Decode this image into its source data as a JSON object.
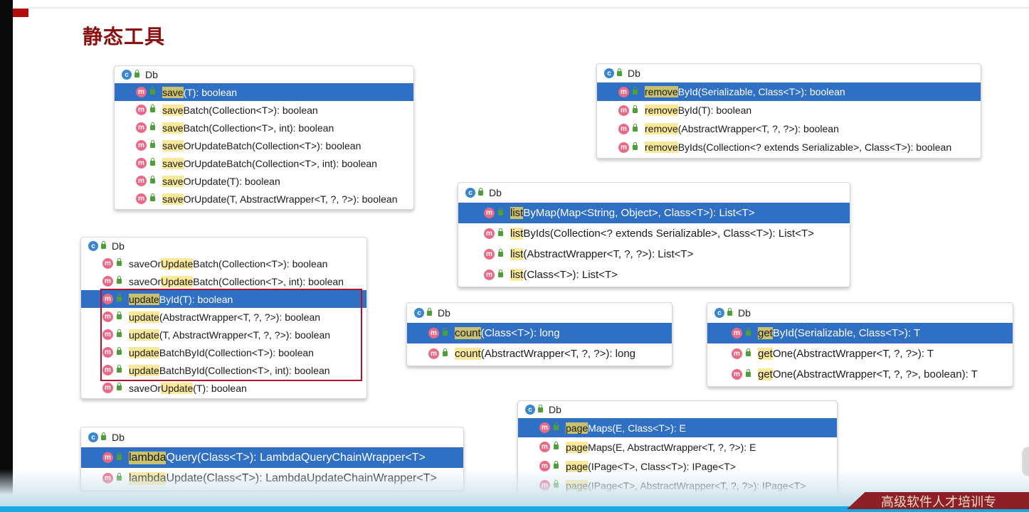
{
  "title": "静态工具",
  "brand_text": "高级软件人才培训专",
  "colors": {
    "accent": "#2f6fc4",
    "title": "#8b1111",
    "highlight": "#fbe99a",
    "box": "#b0142b"
  },
  "panels": [
    {
      "id": "save",
      "header": "Db",
      "sel": 0,
      "rows": [
        {
          "hl": "save",
          "rest": "(T): boolean"
        },
        {
          "hl": "save",
          "rest": "Batch(Collection<T>): boolean"
        },
        {
          "hl": "save",
          "rest": "Batch(Collection<T>, int): boolean"
        },
        {
          "hl": "save",
          "rest": "OrUpdateBatch(Collection<T>): boolean"
        },
        {
          "hl": "save",
          "rest": "OrUpdateBatch(Collection<T>, int): boolean"
        },
        {
          "hl": "save",
          "rest": "OrUpdate(T): boolean"
        },
        {
          "hl": "save",
          "rest": "OrUpdate(T, AbstractWrapper<T, ?, ?>): boolean"
        }
      ]
    },
    {
      "id": "remove",
      "header": "Db",
      "sel": 0,
      "rows": [
        {
          "hl": "remove",
          "rest": "ById(Serializable, Class<T>): boolean"
        },
        {
          "hl": "remove",
          "rest": "ById(T): boolean"
        },
        {
          "hl": "remove",
          "rest": "(AbstractWrapper<T, ?, ?>): boolean"
        },
        {
          "hl": "remove",
          "rest": "ByIds(Collection<? extends Serializable>, Class<T>): boolean"
        }
      ]
    },
    {
      "id": "list",
      "header": "Db",
      "sel": 0,
      "rows": [
        {
          "hl": "list",
          "rest": "ByMap(Map<String, Object>, Class<T>): List<T>"
        },
        {
          "hl": "list",
          "rest": "ByIds(Collection<? extends Serializable>, Class<T>): List<T>"
        },
        {
          "hl": "list",
          "rest": "(AbstractWrapper<T, ?, ?>): List<T>"
        },
        {
          "hl": "list",
          "rest": "(Class<T>): List<T>"
        }
      ]
    },
    {
      "id": "update",
      "header": "Db",
      "sel": 2,
      "rows": [
        {
          "pre": "saveOr",
          "hl": "Update",
          "rest": "Batch(Collection<T>): boolean"
        },
        {
          "pre": "saveOr",
          "hl": "Update",
          "rest": "Batch(Collection<T>, int): boolean"
        },
        {
          "hl": "update",
          "rest": "ById(T): boolean"
        },
        {
          "hl": "update",
          "rest": "(AbstractWrapper<T, ?, ?>): boolean"
        },
        {
          "hl": "update",
          "rest": "(T, AbstractWrapper<T, ?, ?>): boolean"
        },
        {
          "hl": "update",
          "rest": "BatchById(Collection<T>): boolean"
        },
        {
          "hl": "update",
          "rest": "BatchById(Collection<T>, int): boolean"
        },
        {
          "pre": "saveOr",
          "hl": "Update",
          "rest": "(T): boolean"
        }
      ]
    },
    {
      "id": "count",
      "header": "Db",
      "sel": 0,
      "rows": [
        {
          "hl": "count",
          "rest": "(Class<T>): long"
        },
        {
          "hl": "count",
          "rest": "(AbstractWrapper<T, ?, ?>): long"
        }
      ]
    },
    {
      "id": "get",
      "header": "Db",
      "sel": 0,
      "rows": [
        {
          "hl": "get",
          "rest": "ById(Serializable, Class<T>): T"
        },
        {
          "hl": "get",
          "rest": "One(AbstractWrapper<T, ?, ?>): T"
        },
        {
          "hl": "get",
          "rest": "One(AbstractWrapper<T, ?, ?>, boolean): T"
        }
      ]
    },
    {
      "id": "page",
      "header": "Db",
      "sel": 0,
      "rows": [
        {
          "hl": "page",
          "rest": "Maps(E, Class<T>): E"
        },
        {
          "hl": "page",
          "rest": "Maps(E, AbstractWrapper<T, ?, ?>): E"
        },
        {
          "hl": "page",
          "rest": "(IPage<T>, Class<T>): IPage<T>"
        },
        {
          "hl": "page",
          "rest": "(IPage<T>, AbstractWrapper<T, ?, ?>): IPage<T>"
        }
      ]
    },
    {
      "id": "lambda",
      "header": "Db",
      "sel": 0,
      "rows": [
        {
          "hl": "lambda",
          "rest": "Query(Class<T>): LambdaQueryChainWrapper<T>"
        },
        {
          "hl": "lambda",
          "rest": "Update(Class<T>): LambdaUpdateChainWrapper<T>"
        }
      ]
    }
  ]
}
